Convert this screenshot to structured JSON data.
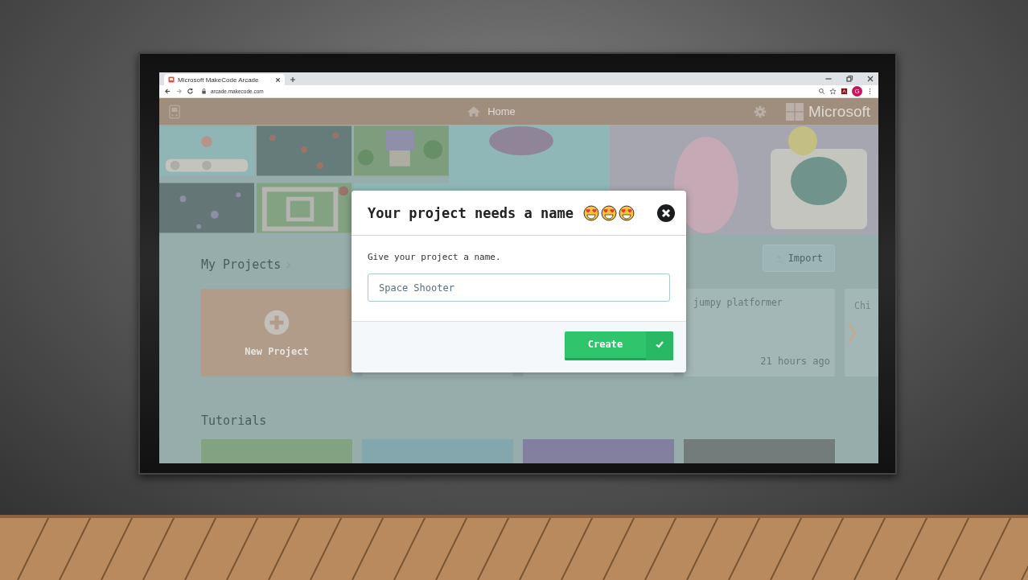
{
  "browser": {
    "tab_title": "Microsoft MakeCode Arcade",
    "address": "arcade.makecode.com",
    "avatar": "G"
  },
  "app": {
    "home": "Home",
    "brand": "Microsoft",
    "my_projects": "My Projects",
    "import": "Import",
    "projects": [
      {
        "kind": "new",
        "label": "New Project"
      },
      {
        "kind": "hidden"
      },
      {
        "kind": "hidden"
      },
      {
        "kind": "project",
        "title": "jumpy platformer",
        "time": "21 hours ago"
      },
      {
        "kind": "partial",
        "title": "Chi"
      }
    ],
    "tutorials": "Tutorials"
  },
  "dialog": {
    "title": "Your project needs a name",
    "prompt": "Give your project a name.",
    "value": "Space Shooter",
    "button": "Create"
  }
}
